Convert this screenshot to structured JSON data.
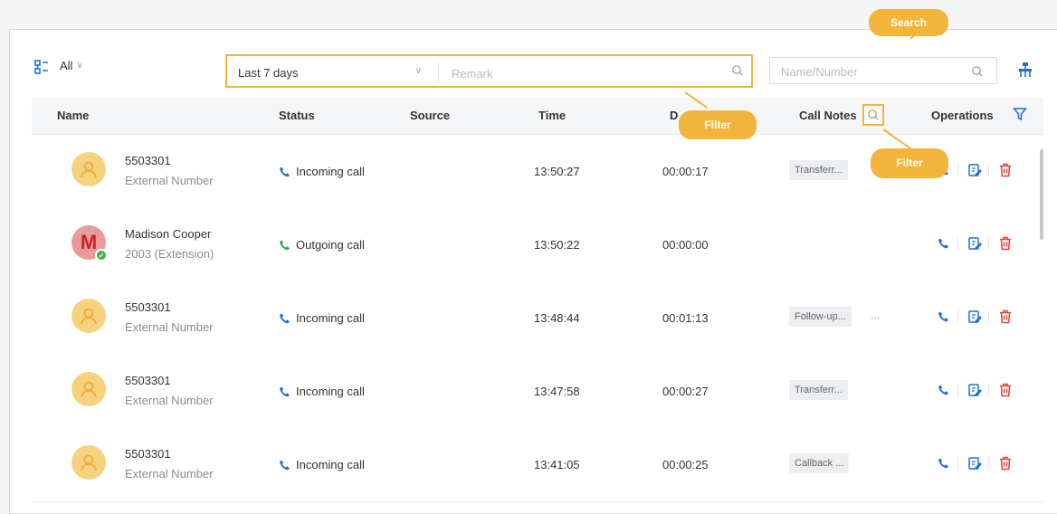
{
  "toolbar": {
    "scope_label": "All",
    "period_value": "Last 7 days",
    "remark_placeholder": "Remark",
    "search_placeholder": "Name/Number"
  },
  "table": {
    "columns": {
      "name": "Name",
      "status": "Status",
      "source": "Source",
      "time": "Time",
      "duration": "D",
      "call_notes": "Call Notes",
      "operations": "Operations"
    },
    "rows": [
      {
        "name": "5503301",
        "sub": "External Number",
        "status": "Incoming call",
        "time": "13:50:27",
        "duration": "00:00:17",
        "note": "Transferr...",
        "more": ""
      },
      {
        "name": "Madison Cooper",
        "sub": "2003 (Extension)",
        "initial": "M",
        "status": "Outgoing call",
        "time": "13:50:22",
        "duration": "00:00:00",
        "note": "",
        "more": ""
      },
      {
        "name": "5503301",
        "sub": "External Number",
        "status": "Incoming call",
        "time": "13:48:44",
        "duration": "00:01:13",
        "note": "Follow-up...",
        "more": "..."
      },
      {
        "name": "5503301",
        "sub": "External Number",
        "status": "Incoming call",
        "time": "13:47:58",
        "duration": "00:00:27",
        "note": "Transferr...",
        "more": ""
      },
      {
        "name": "5503301",
        "sub": "External Number",
        "status": "Incoming call",
        "time": "13:41:05",
        "duration": "00:00:25",
        "note": "Callback ...",
        "more": ""
      }
    ]
  },
  "callouts": {
    "search": "Search",
    "filter_main": "Filter",
    "filter_notes": "Filter"
  },
  "colors": {
    "accent": "#f2b53a",
    "primary": "#1e6fd9",
    "incoming": "#1e6fd9",
    "outgoing": "#2fa84f",
    "delete": "#e0443a"
  }
}
